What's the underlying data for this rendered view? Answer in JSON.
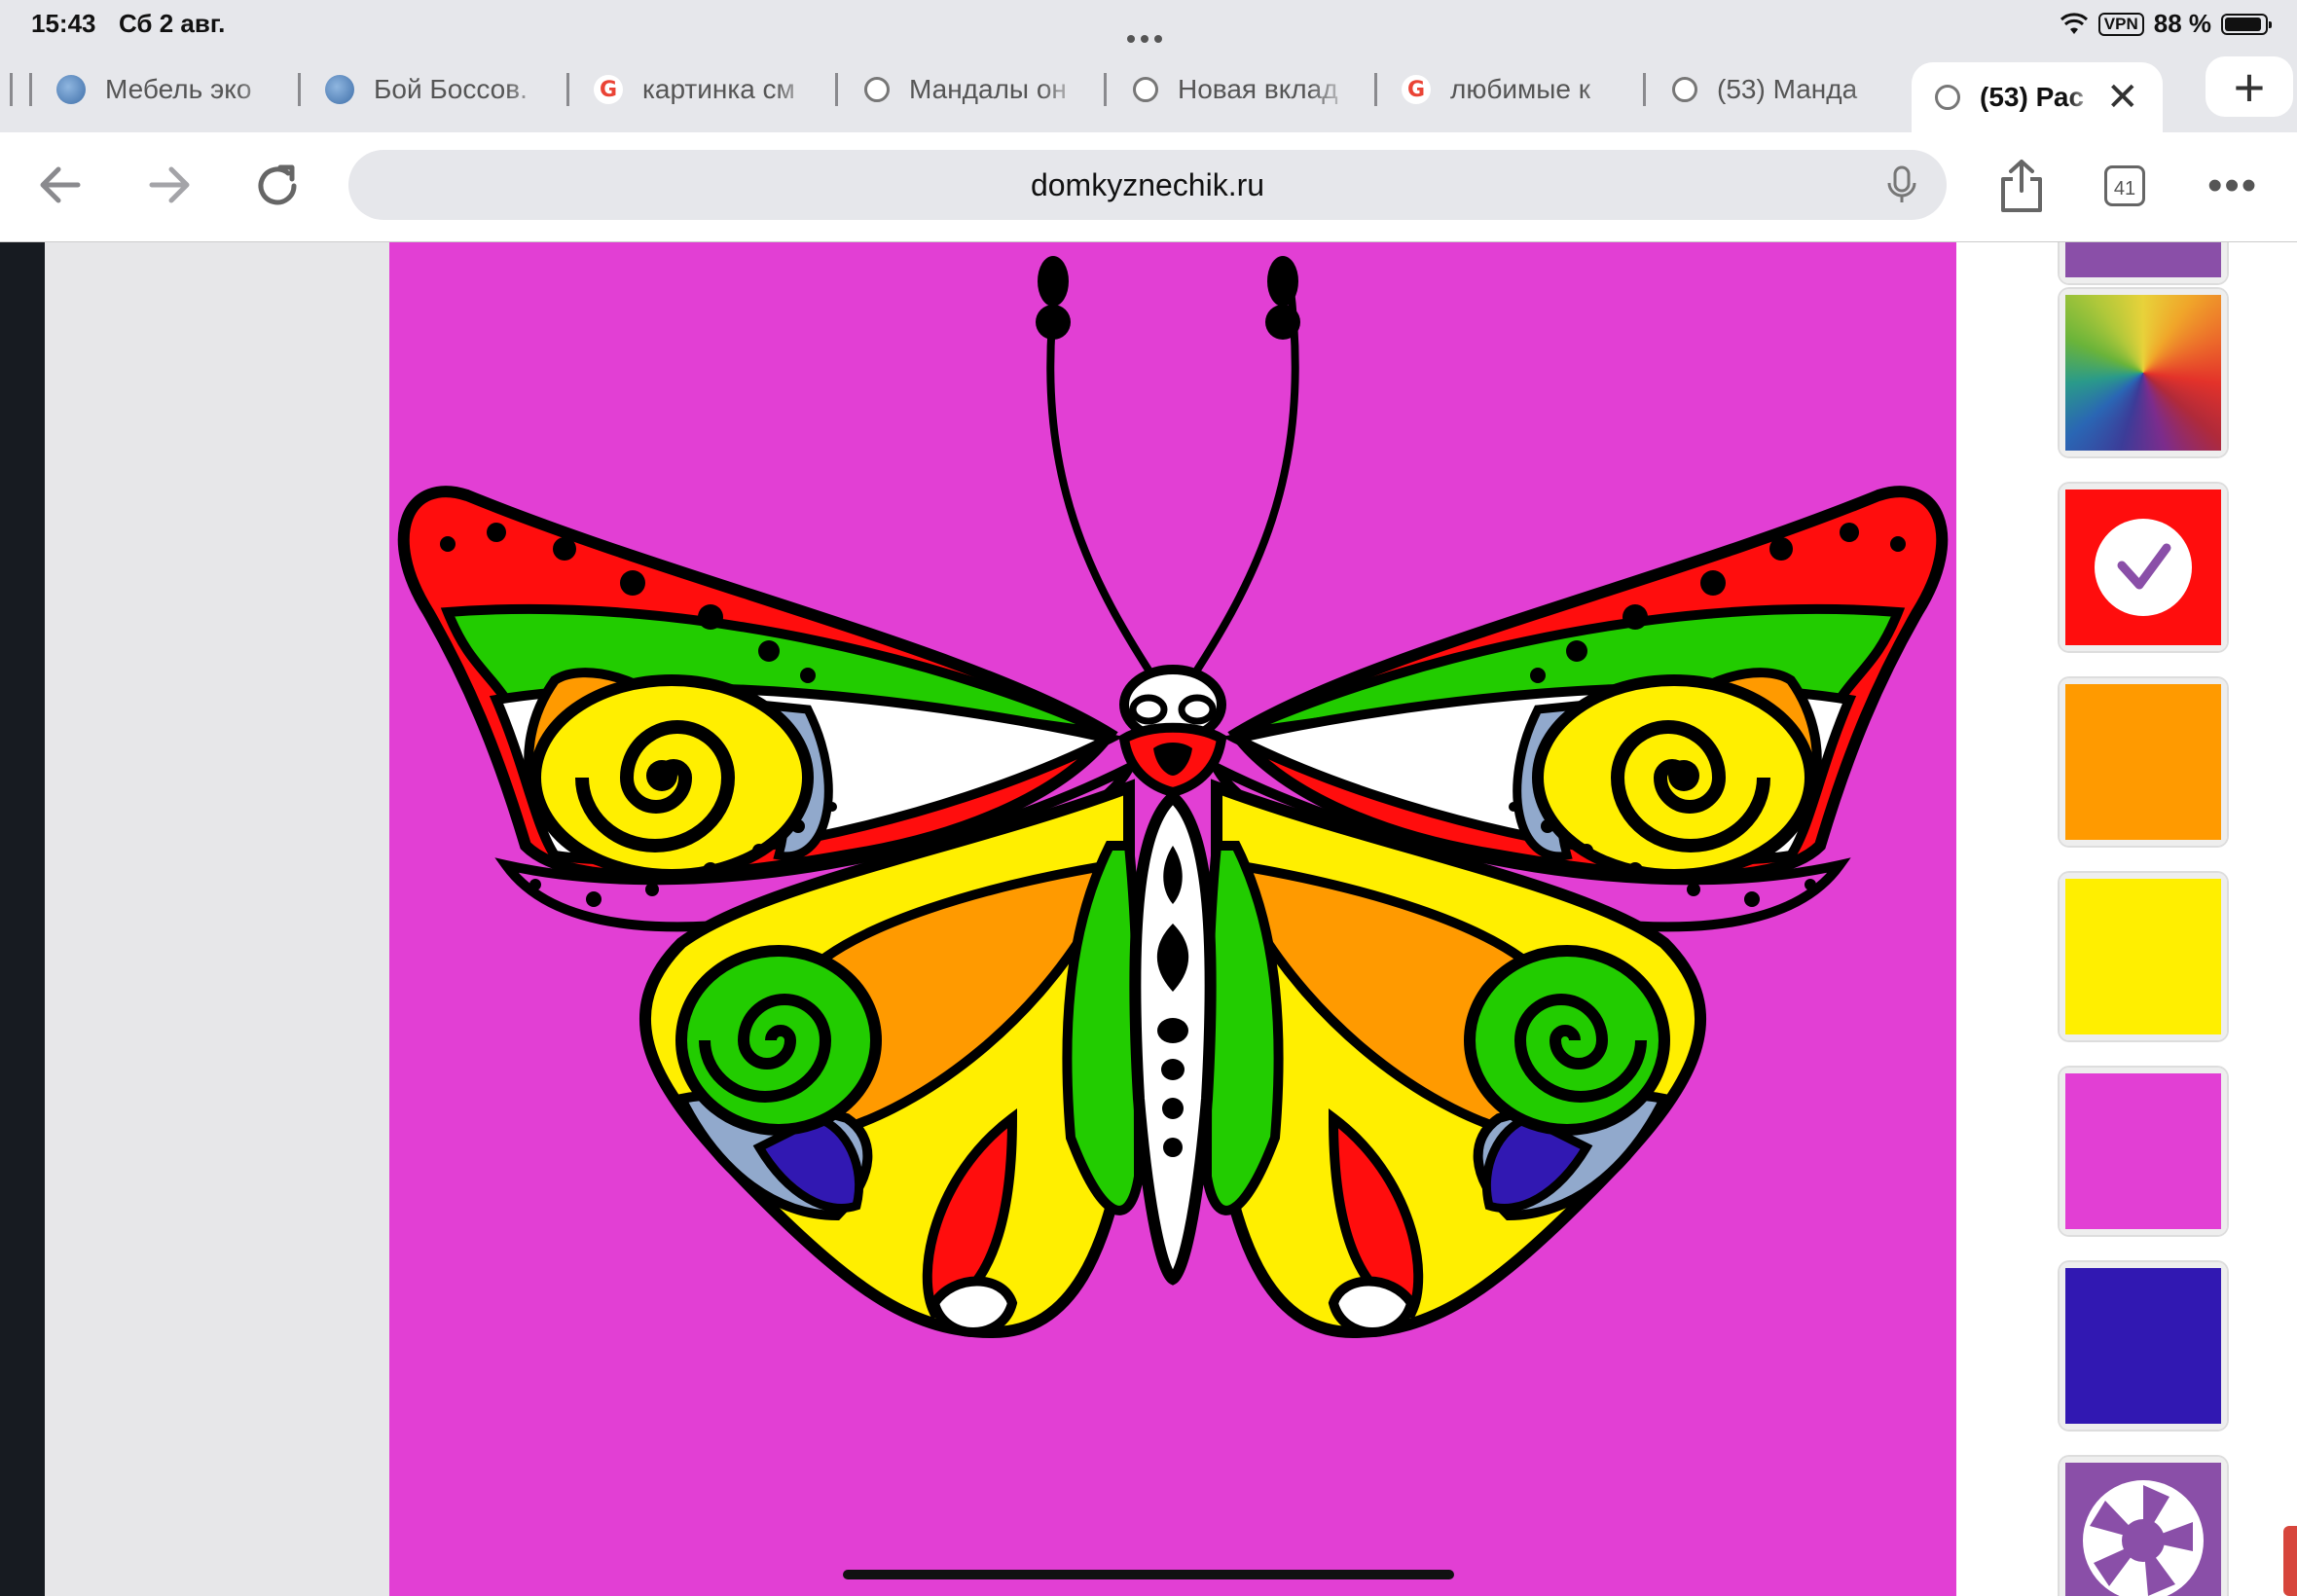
{
  "status_bar": {
    "time": "15:43",
    "date": "Сб 2 авг.",
    "vpn": "VPN",
    "battery": "88 %"
  },
  "tabs": [
    {
      "label": "Мебель эко",
      "favicon": "edge-icon"
    },
    {
      "label": "Бой Боссов.",
      "favicon": "edge-icon"
    },
    {
      "label": "картинка см",
      "favicon": "google-icon"
    },
    {
      "label": "Мандалы он",
      "favicon": "globe-icon"
    },
    {
      "label": "Новая вклад",
      "favicon": "globe-icon"
    },
    {
      "label": "любимые к",
      "favicon": "google-icon"
    },
    {
      "label": "(53) Манда",
      "favicon": "globe-icon"
    },
    {
      "label": "(53) Рас",
      "favicon": "globe-icon",
      "active": true
    }
  ],
  "toolbar": {
    "url": "domkyznechik.ru",
    "tab_count": "41"
  },
  "palette": {
    "colors": [
      "#ff0d0d",
      "#ff9a00",
      "#ffef00",
      "#e23fd4",
      "#3118b2"
    ],
    "selected": "#ff0d0d"
  },
  "canvas": {
    "background": "#e23fd4"
  }
}
